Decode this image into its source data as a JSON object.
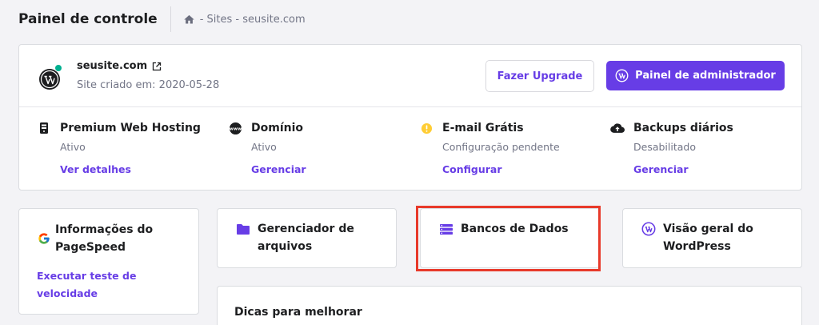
{
  "header": {
    "title": "Painel de controle",
    "breadcrumb": "- Sites - seusite.com"
  },
  "site": {
    "name": "seusite.com",
    "created": "Site criado em: 2020-05-28",
    "upgrade_label": "Fazer Upgrade",
    "admin_label": "Painel de administrador",
    "status_color": "#00b090"
  },
  "services": [
    {
      "icon": "server-icon",
      "title": "Premium Web Hosting",
      "status": "Ativo",
      "link": "Ver detalhes"
    },
    {
      "icon": "www-icon",
      "title": "Domínio",
      "status": "Ativo",
      "link": "Gerenciar"
    },
    {
      "icon": "warning-dot-icon",
      "title": "E-mail Grátis",
      "status": "Configuração pendente",
      "link": "Configurar"
    },
    {
      "icon": "cloud-upload-icon",
      "title": "Backups diários",
      "status": "Desabilitado",
      "link": "Gerenciar"
    }
  ],
  "tiles": {
    "pagespeed": {
      "title_line1": "Informações do",
      "title_line2": "PageSpeed",
      "link_line1": "Executar teste de",
      "link_line2": "velocidade"
    },
    "files": {
      "title_line1": "Gerenciador de",
      "title_line2": "arquivos"
    },
    "databases": {
      "title": "Bancos de Dados"
    },
    "wordpress": {
      "title_line1": "Visão geral do",
      "title_line2": "WordPress"
    }
  },
  "tips": {
    "title": "Dicas para melhorar"
  },
  "colors": {
    "accent": "#673de6",
    "highlight": "#e8392a"
  }
}
